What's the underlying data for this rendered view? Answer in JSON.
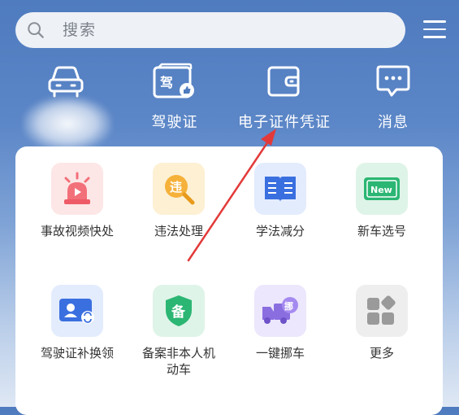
{
  "search": {
    "placeholder": "搜索"
  },
  "top_nav": [
    {
      "label": "",
      "icon": "car-icon"
    },
    {
      "label": "驾驶证",
      "icon": "license-icon",
      "icon_text": "驾"
    },
    {
      "label": "电子证件凭证",
      "icon": "wallet-icon"
    },
    {
      "label": "消息",
      "icon": "message-icon"
    }
  ],
  "services": [
    {
      "label": "事故视频快处",
      "icon": "alarm-siren-icon",
      "color": "#f2707a"
    },
    {
      "label": "违法处理",
      "icon": "violation-search-icon",
      "icon_text": "违",
      "color": "#f5b13a"
    },
    {
      "label": "学法减分",
      "icon": "book-icon",
      "color": "#3a6fe0"
    },
    {
      "label": "新车选号",
      "icon": "new-plate-icon",
      "icon_text": "New",
      "color": "#2bb673"
    },
    {
      "label": "驾驶证补换领",
      "icon": "id-card-icon",
      "color": "#3a6fe0"
    },
    {
      "label": "备案非本人机动车",
      "icon": "shield-icon",
      "icon_text": "备",
      "color": "#2bb673"
    },
    {
      "label": "一键挪车",
      "icon": "truck-icon",
      "icon_text": "挪",
      "color": "#8a6ee0"
    },
    {
      "label": "更多",
      "icon": "more-grid-icon",
      "color": "#9a9a9a"
    }
  ]
}
